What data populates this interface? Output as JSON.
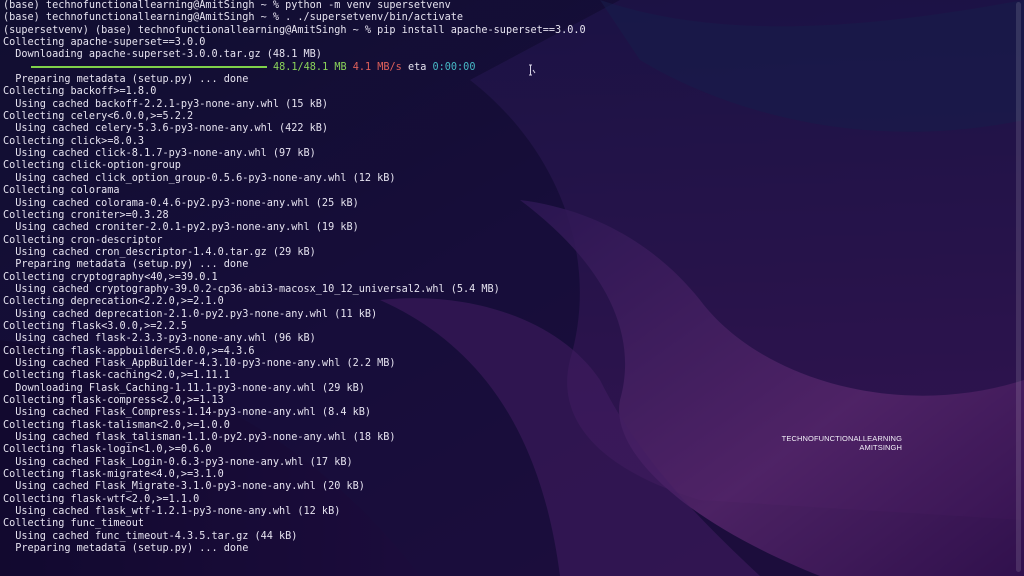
{
  "terminal": {
    "lines": [
      "(base) technofunctionallearning@AmitSingh ~ % python -m venv supersetvenv",
      "(base) technofunctionallearning@AmitSingh ~ % . ./supersetvenv/bin/activate",
      "(supersetvenv) (base) technofunctionallearning@AmitSingh ~ % pip install apache-superset==3.0.0",
      "Collecting apache-superset==3.0.0",
      "  Downloading apache-superset-3.0.0.tar.gz (48.1 MB)",
      "PROGRESS",
      "  Preparing metadata (setup.py) ... done",
      "Collecting backoff>=1.8.0",
      "  Using cached backoff-2.2.1-py3-none-any.whl (15 kB)",
      "Collecting celery<6.0.0,>=5.2.2",
      "  Using cached celery-5.3.6-py3-none-any.whl (422 kB)",
      "Collecting click>=8.0.3",
      "  Using cached click-8.1.7-py3-none-any.whl (97 kB)",
      "Collecting click-option-group",
      "  Using cached click_option_group-0.5.6-py3-none-any.whl (12 kB)",
      "Collecting colorama",
      "  Using cached colorama-0.4.6-py2.py3-none-any.whl (25 kB)",
      "Collecting croniter>=0.3.28",
      "  Using cached croniter-2.0.1-py2.py3-none-any.whl (19 kB)",
      "Collecting cron-descriptor",
      "  Using cached cron_descriptor-1.4.0.tar.gz (29 kB)",
      "  Preparing metadata (setup.py) ... done",
      "Collecting cryptography<40,>=39.0.1",
      "  Using cached cryptography-39.0.2-cp36-abi3-macosx_10_12_universal2.whl (5.4 MB)",
      "Collecting deprecation<2.2.0,>=2.1.0",
      "  Using cached deprecation-2.1.0-py2.py3-none-any.whl (11 kB)",
      "Collecting flask<3.0.0,>=2.2.5",
      "  Using cached flask-2.3.3-py3-none-any.whl (96 kB)",
      "Collecting flask-appbuilder<5.0.0,>=4.3.6",
      "  Using cached Flask_AppBuilder-4.3.10-py3-none-any.whl (2.2 MB)",
      "Collecting flask-caching<2.0,>=1.11.1",
      "  Downloading Flask_Caching-1.11.1-py3-none-any.whl (29 kB)",
      "Collecting flask-compress<2.0,>=1.13",
      "  Using cached Flask_Compress-1.14-py3-none-any.whl (8.4 kB)",
      "Collecting flask-talisman<2.0,>=1.0.0",
      "  Using cached flask_talisman-1.1.0-py2.py3-none-any.whl (18 kB)",
      "Collecting flask-login<1.0,>=0.6.0",
      "  Using cached Flask_Login-0.6.3-py3-none-any.whl (17 kB)",
      "Collecting flask-migrate<4.0,>=3.1.0",
      "  Using cached Flask_Migrate-3.1.0-py3-none-any.whl (20 kB)",
      "Collecting flask-wtf<2.0,>=1.1.0",
      "  Using cached flask_wtf-1.2.1-py3-none-any.whl (12 kB)",
      "Collecting func_timeout",
      "  Using cached func_timeout-4.3.5.tar.gz (44 kB)",
      "  Preparing metadata (setup.py) ... done"
    ],
    "progress": {
      "fraction": 1.0,
      "size": "48.1/48.1 MB",
      "speed": "4.1 MB/s",
      "eta_label": "eta",
      "eta": "0:00:00"
    }
  },
  "watermark": {
    "line1": "TECHNOFUNCTIONALLEARNING",
    "line2": "AMITSINGH"
  },
  "colors": {
    "progress_bar": "#7fd14a",
    "speed": "#e0605a",
    "eta": "#46b7c4"
  }
}
